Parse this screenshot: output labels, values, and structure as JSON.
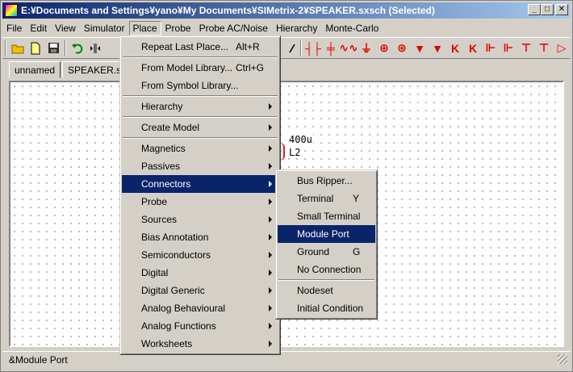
{
  "window": {
    "title": "E:¥Documents and Settings¥yano¥My Documents¥SIMetrix-2¥SPEAKER.sxsch (Selected)",
    "controls": {
      "minimize": "_",
      "maximize": "□",
      "close": "✕"
    }
  },
  "menubar": {
    "items": [
      {
        "label": "File"
      },
      {
        "label": "Edit"
      },
      {
        "label": "View"
      },
      {
        "label": "Simulator"
      },
      {
        "label": "Place"
      },
      {
        "label": "Probe"
      },
      {
        "label": "Probe AC/Noise"
      },
      {
        "label": "Hierarchy"
      },
      {
        "label": "Monte-Carlo"
      }
    ]
  },
  "toolbar": {
    "icons": [
      "open-folder-icon",
      "new-file-icon",
      "save-icon",
      "undo-icon",
      "flip-icon",
      "rotate-icon"
    ],
    "component_glyphs": [
      "┤├",
      "╪",
      "∿∿",
      "⏚",
      "⊕",
      "⊛",
      "▼",
      "▼",
      "K",
      "K",
      "⊩",
      "⊩",
      "⊤",
      "⊤",
      "▷"
    ]
  },
  "tabs": [
    {
      "label": "unnamed"
    },
    {
      "label": "SPEAKER.sxsch"
    }
  ],
  "canvas": {
    "component_value": "400u",
    "component_ref": "L2"
  },
  "place_menu": {
    "items": [
      {
        "label": "Repeat Last Place...",
        "shortcut": "Alt+R",
        "submenu": false
      },
      {
        "divider": true
      },
      {
        "label": "From Model Library...",
        "shortcut": "Ctrl+G",
        "submenu": false
      },
      {
        "label": "From Symbol Library...",
        "shortcut": "",
        "submenu": false
      },
      {
        "divider": true
      },
      {
        "label": "Hierarchy",
        "shortcut": "",
        "submenu": true
      },
      {
        "divider": true
      },
      {
        "label": "Create Model",
        "shortcut": "",
        "submenu": true
      },
      {
        "divider": true
      },
      {
        "label": "Magnetics",
        "shortcut": "",
        "submenu": true
      },
      {
        "label": "Passives",
        "shortcut": "",
        "submenu": true
      },
      {
        "label": "Connectors",
        "shortcut": "",
        "submenu": true,
        "highlighted": true
      },
      {
        "label": "Probe",
        "shortcut": "",
        "submenu": true
      },
      {
        "label": "Sources",
        "shortcut": "",
        "submenu": true
      },
      {
        "label": "Bias Annotation",
        "shortcut": "",
        "submenu": true
      },
      {
        "label": "Semiconductors",
        "shortcut": "",
        "submenu": true
      },
      {
        "label": "Digital",
        "shortcut": "",
        "submenu": true
      },
      {
        "label": "Digital Generic",
        "shortcut": "",
        "submenu": true
      },
      {
        "label": "Analog Behavioural",
        "shortcut": "",
        "submenu": true
      },
      {
        "label": "Analog Functions",
        "shortcut": "",
        "submenu": true
      },
      {
        "label": "Worksheets",
        "shortcut": "",
        "submenu": true
      }
    ]
  },
  "connectors_menu": {
    "items": [
      {
        "label": "Bus Ripper...",
        "shortcut": ""
      },
      {
        "label": "Terminal",
        "shortcut": "Y"
      },
      {
        "label": "Small Terminal",
        "shortcut": ""
      },
      {
        "label": "Module Port",
        "shortcut": "",
        "highlighted": true
      },
      {
        "label": "Ground",
        "shortcut": "G"
      },
      {
        "label": "No Connection",
        "shortcut": ""
      },
      {
        "divider": true
      },
      {
        "label": "Nodeset",
        "shortcut": ""
      },
      {
        "label": "Initial Condition",
        "shortcut": ""
      }
    ]
  },
  "statusbar": {
    "text": "&Module Port"
  },
  "colors": {
    "title_start": "#0a246a",
    "title_end": "#a6caf0",
    "highlight": "#0a246a",
    "component_red": "#e00000",
    "face": "#d4d0c8"
  }
}
